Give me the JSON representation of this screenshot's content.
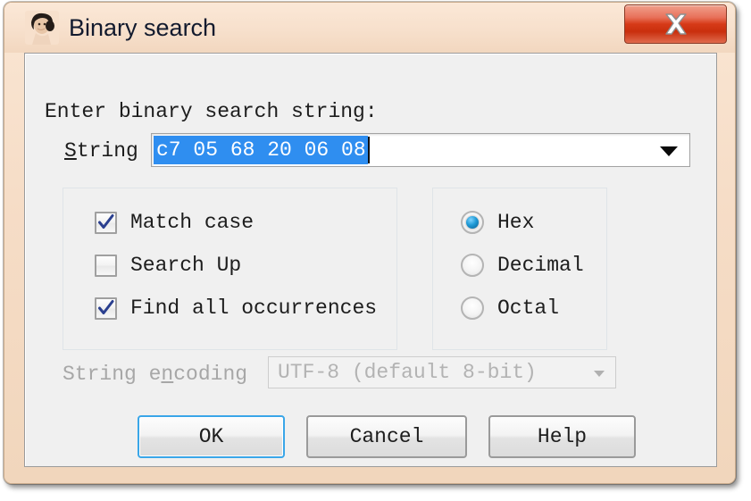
{
  "window": {
    "title": "Binary search",
    "icon": "portrait-icon",
    "close_label": "x",
    "frame_color": "#f4ddc6",
    "client_color": "#f0f0f0"
  },
  "form": {
    "prompt": "Enter binary search string:",
    "string_label": "String",
    "string_label_mnemonic": "S",
    "string_value": "c7 05 68 20 06 08",
    "string_selected": true,
    "selection_color": "#2f8ef0",
    "dropdown_icon": "chevron-down-icon"
  },
  "options": {
    "items": [
      {
        "label": "Match case",
        "checked": true
      },
      {
        "label": "Search Up",
        "checked": false
      },
      {
        "label": "Find all occurrences",
        "checked": true
      }
    ]
  },
  "base": {
    "items": [
      {
        "label": "Hex",
        "selected": true
      },
      {
        "label": "Decimal",
        "selected": false
      },
      {
        "label": "Octal",
        "selected": false
      }
    ]
  },
  "encoding": {
    "label_pre": "String e",
    "label_mnemonic": "n",
    "label_post": "coding",
    "value": "UTF-8 (default 8-bit)",
    "disabled": true,
    "dropdown_icon": "chevron-down-icon"
  },
  "buttons": {
    "ok": "OK",
    "cancel": "Cancel",
    "help": "Help",
    "default": "ok"
  }
}
